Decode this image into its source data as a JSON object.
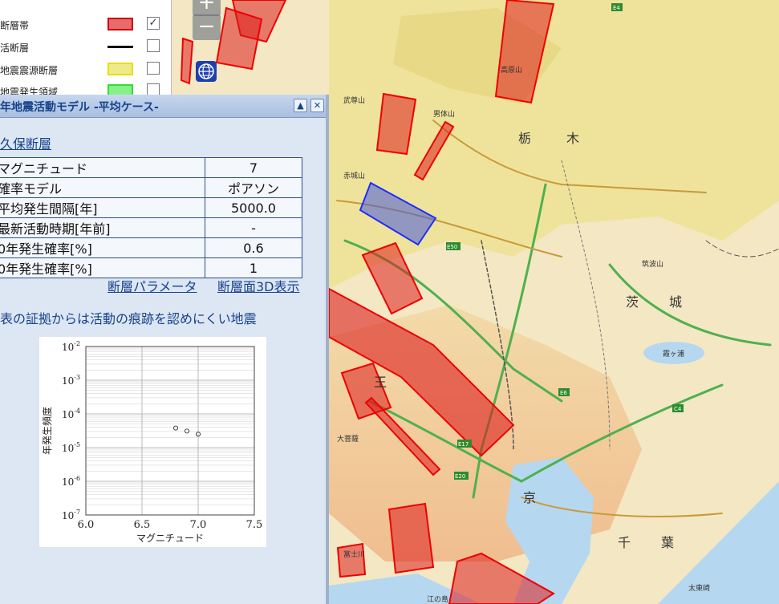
{
  "legend": {
    "items": [
      {
        "label": "断層帯",
        "color": "#e86a6a",
        "border": "#cc0000",
        "checked": "✓"
      },
      {
        "label": "活断層",
        "color": "#000000",
        "checked": ""
      },
      {
        "label": "地震震源断層",
        "color": "#eeea8a",
        "border": "#e6e000",
        "checked": ""
      },
      {
        "label": "地震発生領域",
        "color": "#88f088",
        "border": "#33dd33",
        "checked": ""
      }
    ]
  },
  "map_controls": {
    "zoom_in": "+",
    "zoom_out": "−"
  },
  "panel": {
    "title": "年地震活動モデル -平均ケース-",
    "collapse_icon": "▲",
    "close_icon": "✕",
    "fault_name": "久保断層",
    "params": [
      {
        "key": "マグニチュード",
        "value": "7"
      },
      {
        "key": "確率モデル",
        "value": "ポアソン"
      },
      {
        "key": "平均発生間隔[年]",
        "value": "5000.0"
      },
      {
        "key": "最新活動時期[年前]",
        "value": "-"
      },
      {
        "key": "0年発生確率[%]",
        "value": "0.6"
      },
      {
        "key": "0年発生確率[%]",
        "value": "1"
      }
    ],
    "link_params": "断層パラメータ",
    "link_3d": "断層面3D表示",
    "description": "表の証拠からは活動の痕跡を認めにくい地震"
  },
  "map_labels": [
    {
      "text": "栃",
      "kind": "pref"
    },
    {
      "text": "木",
      "kind": "pref"
    },
    {
      "text": "茨",
      "kind": "pref"
    },
    {
      "text": "城",
      "kind": "pref"
    },
    {
      "text": "王",
      "kind": "pref"
    },
    {
      "text": "京",
      "kind": "pref"
    },
    {
      "text": "千",
      "kind": "pref"
    },
    {
      "text": "葉",
      "kind": "pref"
    },
    {
      "text": "高原山",
      "kind": "place"
    },
    {
      "text": "男体山",
      "kind": "place"
    },
    {
      "text": "赤城山",
      "kind": "place"
    },
    {
      "text": "武尊山",
      "kind": "place"
    },
    {
      "text": "筑波山",
      "kind": "place"
    },
    {
      "text": "霞ヶ浦",
      "kind": "place"
    },
    {
      "text": "大菩薩",
      "kind": "place"
    },
    {
      "text": "富士川",
      "kind": "place"
    },
    {
      "text": "江の島",
      "kind": "place"
    },
    {
      "text": "太東崎",
      "kind": "place"
    },
    {
      "text": "E4",
      "kind": "road"
    },
    {
      "text": "E50",
      "kind": "road"
    },
    {
      "text": "E17",
      "kind": "road"
    },
    {
      "text": "E20",
      "kind": "road"
    },
    {
      "text": "E6",
      "kind": "road"
    },
    {
      "text": "C4",
      "kind": "road"
    }
  ],
  "chart_data": {
    "type": "scatter",
    "xlabel": "マグニチュード",
    "ylabel": "年発生頻度",
    "xlim": [
      6.0,
      7.5
    ],
    "ylim_exp": [
      -7,
      -2
    ],
    "xticks": [
      "6.0",
      "6.5",
      "7.0",
      "7.5"
    ],
    "yticks": [
      {
        "base": "10",
        "exp": "-2"
      },
      {
        "base": "10",
        "exp": "-3"
      },
      {
        "base": "10",
        "exp": "-4"
      },
      {
        "base": "10",
        "exp": "-5"
      },
      {
        "base": "10",
        "exp": "-6"
      },
      {
        "base": "10",
        "exp": "-7"
      }
    ],
    "points": [
      {
        "x": 6.8,
        "y": 3.8e-05
      },
      {
        "x": 6.9,
        "y": 3.1e-05
      },
      {
        "x": 7.0,
        "y": 2.5e-05
      }
    ],
    "grid": true
  },
  "colors": {
    "fault_zone_fill": "rgba(220,30,30,0.55)",
    "fault_zone_stroke": "#ee0000",
    "selected_fault_fill": "rgba(70,90,220,0.55)",
    "selected_fault_stroke": "#1f2cff",
    "panel_bg": "#dde6f3",
    "panel_title": "#15428b"
  }
}
